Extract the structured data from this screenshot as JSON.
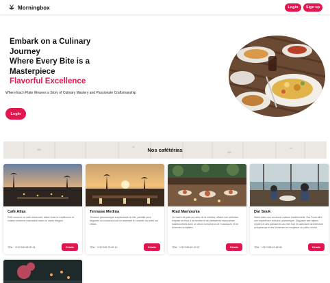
{
  "brand": {
    "name": "Morningbox",
    "icon": "bowl-chopsticks-icon"
  },
  "nav": {
    "login_label": "Login",
    "signup_label": "Sign up"
  },
  "hero": {
    "title_lines": [
      "Embark on a Culinary",
      "Journey",
      "Where Every Bite is a",
      "Masterpiece"
    ],
    "title_accent": "Flavorful Excellence",
    "subtitle": "Where Each Plate Weaves a Story of Culinary Mastery and Passionate Craftsmanship",
    "login_label": "Login"
  },
  "section": {
    "title": "Nos cafétérias"
  },
  "cards": [
    {
      "name": "Café Atlas",
      "description": "Petit convent un café restaurant, atlant charme traditionnel et cuisine moderne marocaine dans un cadre élégant",
      "tel": "TÉlé : +212 530 65 30 24",
      "button": "Détails"
    },
    {
      "name": "Terrasse Medina",
      "description": "Terrasse panoramique surplombant la ville, parfaite pour déguster un couscous tout en admirant le coucher du soleil sur l'Atlas.",
      "tel": "TÉlé : +212 535 75 89 10",
      "button": "Détails"
    },
    {
      "name": "Riad Mamounia",
      "description": "Un havre de paix au cœur de la médina, offrant une sélection exquise de thés à la menthe et de pâtisseries marocaines traditionnelles dans un décor somptueux de mosaïques et de boiseries sculptées.",
      "tel": "TÉlé : +212 535 62 10 97",
      "button": "Détails"
    },
    {
      "name": "Dar Souk",
      "description": "Niché dans une ancienne maison traditionnelle, Dar Souk offre une expérience culinaire authentique. Dégustez des tajines mijotés et des pâtisseries au miel tout en admirant l'architecture somptueuse et les fontaines se remplacer au patio central.",
      "tel": "TÉlé : +212 535 43 45 98",
      "button": "Détails"
    }
  ],
  "colors": {
    "accent": "#e3174f",
    "text": "#111111"
  }
}
